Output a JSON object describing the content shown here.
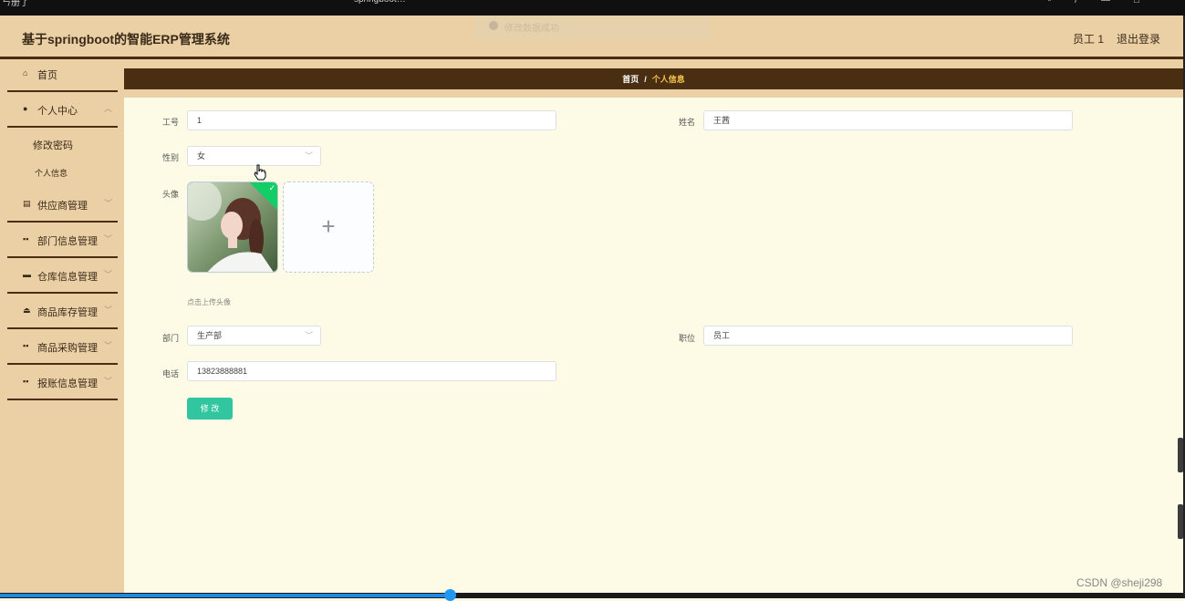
{
  "app": {
    "title": "基于springboot的智能ERP管理系统",
    "user": "员工 1",
    "logout": "退出登录"
  },
  "toast": {
    "text": "修改数据成功"
  },
  "sidebar": {
    "items": [
      {
        "label": "首页",
        "icon": "home-icon"
      },
      {
        "label": "个人中心",
        "icon": "user-icon"
      },
      {
        "label": "供应商管理",
        "icon": "document-icon"
      },
      {
        "label": "部门信息管理",
        "icon": "grid-icon"
      },
      {
        "label": "仓库信息管理",
        "icon": "warehouse-icon"
      },
      {
        "label": "商品库存管理",
        "icon": "person-upload-icon"
      },
      {
        "label": "商品采购管理",
        "icon": "grid-icon"
      },
      {
        "label": "报账信息管理",
        "icon": "grid-icon"
      }
    ],
    "sub_items": [
      {
        "label": "修改密码"
      },
      {
        "label": "个人信息"
      }
    ]
  },
  "breadcrumb": {
    "home": "首页",
    "separator": "/",
    "current": "个人信息"
  },
  "form": {
    "job_no": {
      "label": "工号",
      "value": "1"
    },
    "name": {
      "label": "姓名",
      "value": "王茜"
    },
    "gender": {
      "label": "性别",
      "value": "女"
    },
    "avatar": {
      "label": "头像",
      "tip": "点击上传头像"
    },
    "department": {
      "label": "部门",
      "value": "生产部"
    },
    "position": {
      "label": "职位",
      "value": "员工"
    },
    "phone": {
      "label": "电话",
      "value": "13823888881"
    },
    "submit": "修 改"
  },
  "video_progress": 0.38,
  "watermark": "CSDN @sheji298",
  "colors": {
    "header": "#ebd0a6",
    "accent_dark": "#4a2e12",
    "breadcrumb_current": "#f3c44c",
    "button": "#31c6a0",
    "background": "#fdfbe6"
  }
}
